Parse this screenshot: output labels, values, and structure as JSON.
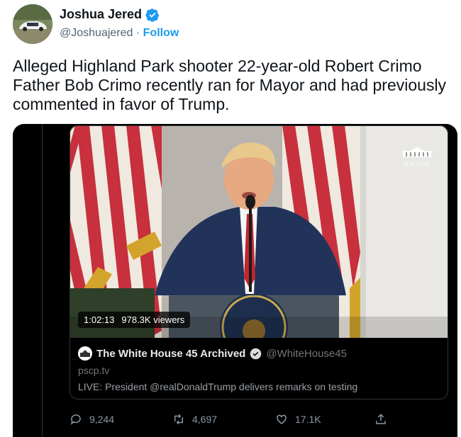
{
  "author": {
    "name": "Joshua Jered",
    "handle": "@Joshuajered",
    "separator": "·",
    "follow_label": "Follow",
    "avatar_icon": "car-photo-avatar",
    "verified_icon": "verified-badge-icon",
    "verified_color": "#1d9bf0"
  },
  "tweet": {
    "text": "Alleged Highland Park shooter 22-year-old Robert Crimo Father Bob Crimo recently ran for Mayor and had previously commented in favor of Trump."
  },
  "embedded": {
    "video": {
      "duration": "1:02:13",
      "viewers": "978.3K viewers",
      "watermark": "WH.GOV",
      "seal_text": "PRESIDENT OF THE UNITED STATES"
    },
    "preview": {
      "account_name": "The White House 45 Archived",
      "account_handle": "@WhiteHouse45",
      "domain": "pscp.tv",
      "description": "LIVE: President @realDonaldTrump delivers remarks on testing"
    }
  },
  "actions": {
    "reply_count": "9,244",
    "retweet_count": "4,697",
    "like_count": "17.1K",
    "share_label": ""
  },
  "colors": {
    "accent": "#1d9bf0",
    "card_bg": "#000000",
    "muted": "#536471"
  }
}
